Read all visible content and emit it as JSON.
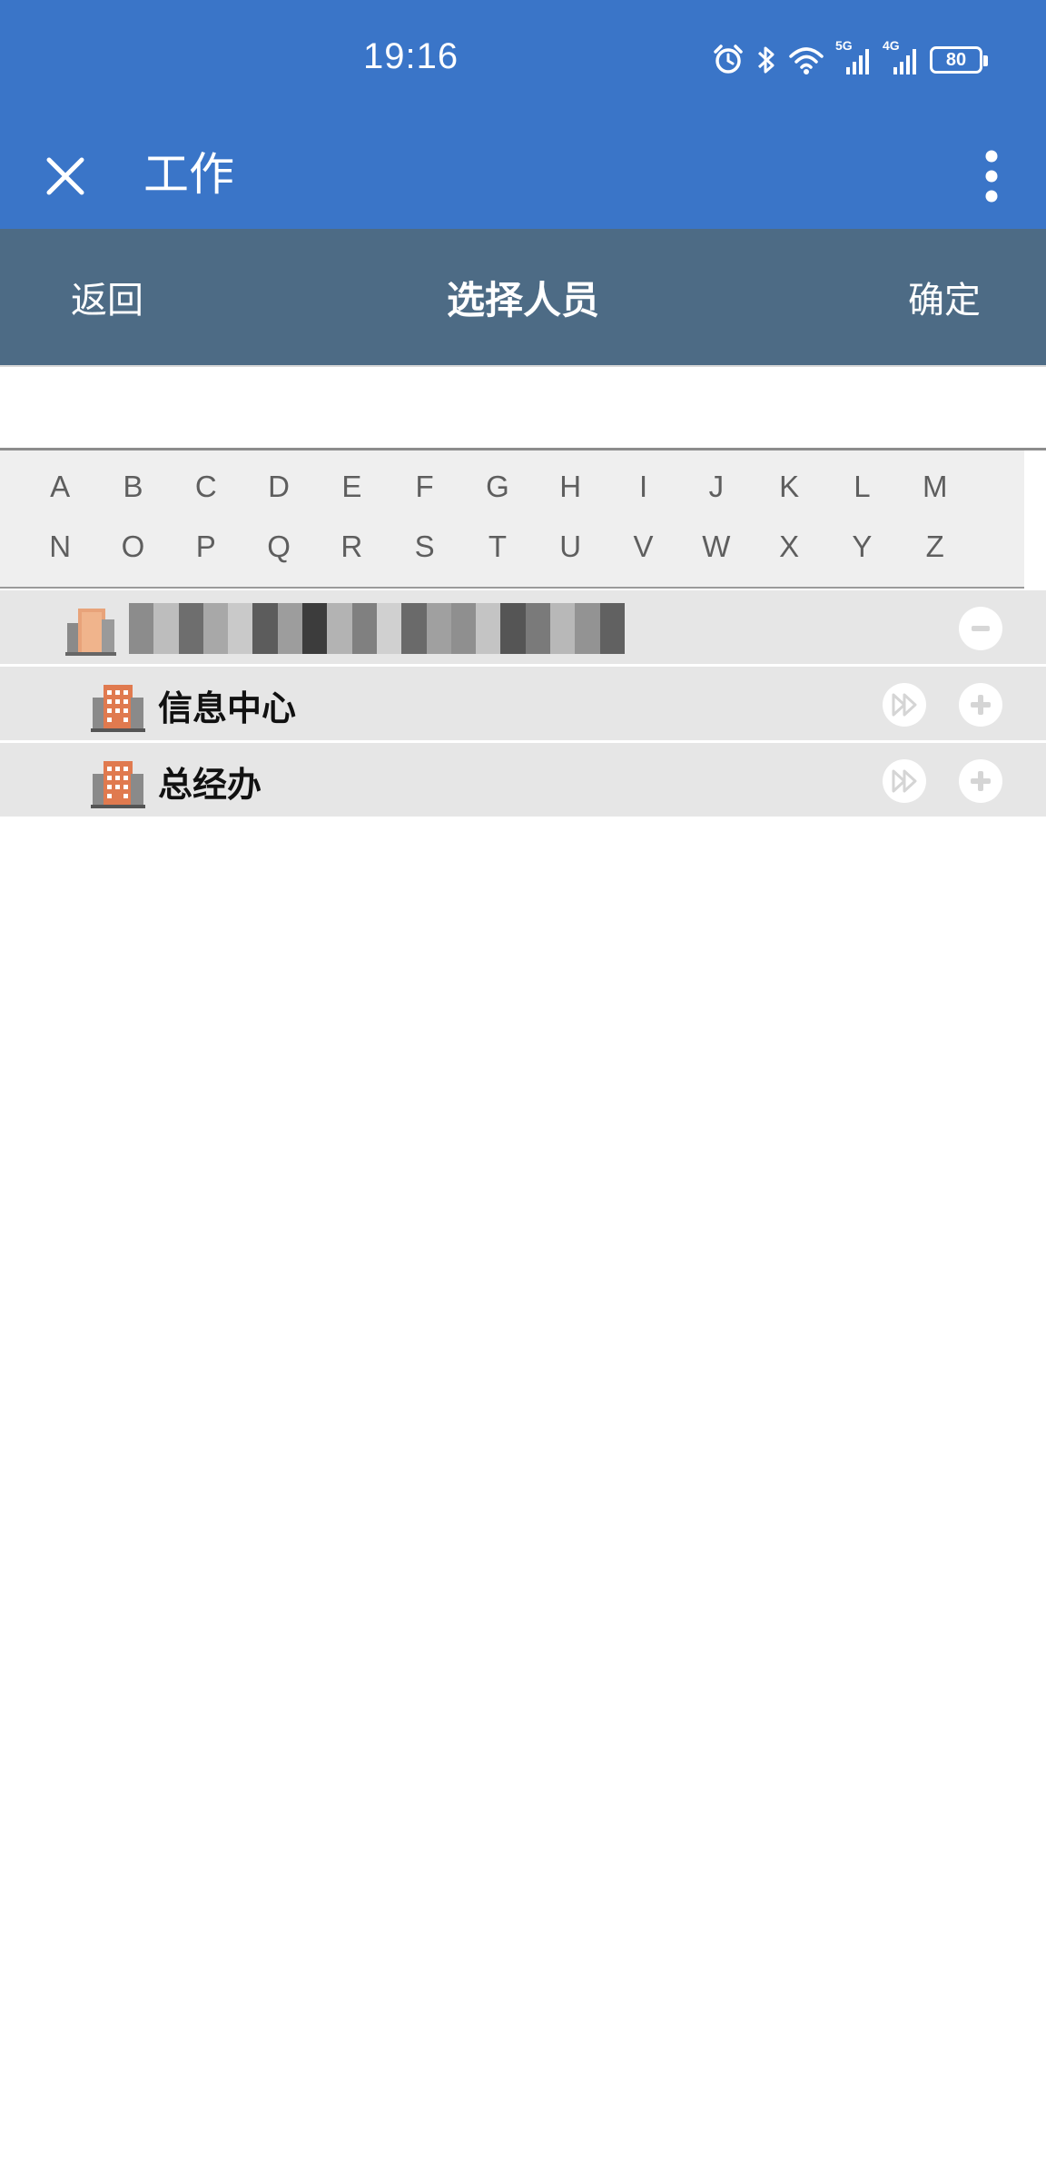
{
  "status_bar": {
    "time": "19:16",
    "network_labels": [
      "5G",
      "4G"
    ],
    "battery": "80",
    "icons": [
      "alarm-icon",
      "bluetooth-icon",
      "wifi-icon",
      "signal-5g-icon",
      "signal-4g-icon",
      "battery-icon"
    ]
  },
  "header": {
    "title": "工作",
    "close_icon": "close-icon",
    "more_icon": "more-vertical-icon"
  },
  "subheader": {
    "back_label": "返回",
    "title": "选择人员",
    "confirm_label": "确定"
  },
  "search": {
    "value": "",
    "placeholder": ""
  },
  "alphabet": {
    "row1": [
      "A",
      "B",
      "C",
      "D",
      "E",
      "F",
      "G",
      "H",
      "I",
      "J",
      "K",
      "L",
      "M"
    ],
    "row2": [
      "N",
      "O",
      "P",
      "Q",
      "R",
      "S",
      "T",
      "U",
      "V",
      "W",
      "X",
      "Y",
      "Z"
    ]
  },
  "tree": {
    "root": {
      "label_redacted": true,
      "expanded": true,
      "action_icon": "collapse-minus-icon"
    },
    "children": [
      {
        "label": "信息中心",
        "icons": [
          "fast-forward-icon",
          "add-plus-icon"
        ]
      },
      {
        "label": "总经办",
        "icons": [
          "fast-forward-icon",
          "add-plus-icon"
        ]
      }
    ]
  },
  "colors": {
    "header_blue": "#3a75c8",
    "subheader_slate": "#4d6b85",
    "row_gray": "#e6e6e6",
    "alphabet_bg": "#efefef"
  }
}
